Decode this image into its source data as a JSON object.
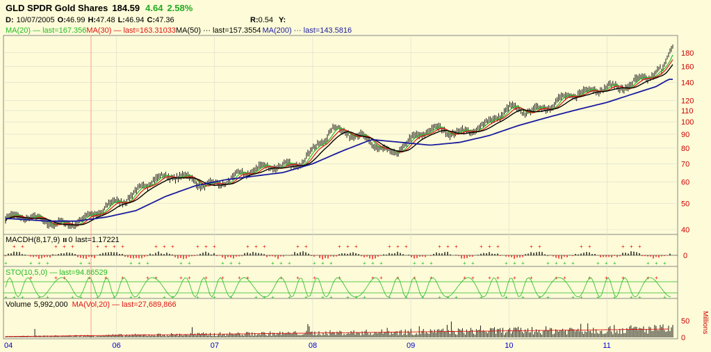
{
  "header": {
    "ticker_name": "GLD SPDR Gold Shares",
    "price": "184.59",
    "change": "4.64",
    "change_pct": "2.58%",
    "ohlc": [
      {
        "label": "D:",
        "value": "10/07/2005"
      },
      {
        "label": "O:",
        "value": "46.99"
      },
      {
        "label": "H:",
        "value": "47.48"
      },
      {
        "label": "L:",
        "value": "46.94"
      },
      {
        "label": "C:",
        "value": "47.36"
      }
    ],
    "r_label": "R:",
    "r_value": "0.54",
    "y_label": "Y:"
  },
  "ma_legend": [
    {
      "text": "MA(20)",
      "last": "last=167.356",
      "color": "#22bb22"
    },
    {
      "text": "MA(30)",
      "last": "last=163.31033",
      "color": "#dd1111"
    },
    {
      "text": "MA(50)",
      "last": "last=157.3554",
      "color": "#000000"
    },
    {
      "text": "MA(200)",
      "last": "last=143.5816",
      "color": "#1a1a9e"
    }
  ],
  "macd_legend": "MACDH(8,17,9)",
  "macd_zero": "0",
  "macd_last": "last=1.17221",
  "sto_legend": "STO(10,5,0)",
  "sto_last": "last=94.86529",
  "volume_legend": "Volume",
  "volume_value": "5,992,000",
  "vol_ma_legend": "MA(Vol,20)",
  "vol_ma_last": "last=27,689,866",
  "volume_unit": "Millions",
  "colors": {
    "background": "#fdfbd8",
    "frame": "#888888",
    "grid": "#d8d8c8",
    "price_axis": "#cc0000",
    "date_axis": "#0000cc",
    "candle": "#000000",
    "ma20": "#22bb22",
    "ma30": "#dd1111",
    "ma50": "#000000",
    "ma200": "#1a1a9e",
    "sto": "#22bb22"
  },
  "chart_data": {
    "type": "line",
    "scale": "log",
    "price_ticks": [
      40,
      50,
      60,
      70,
      80,
      90,
      100,
      110,
      120,
      140,
      160,
      180
    ],
    "macd_ticks": [
      0
    ],
    "volume_ticks": [
      0,
      50
    ],
    "x_tick_labels": [
      "04",
      "06",
      "07",
      "08",
      "09",
      "10",
      "11"
    ],
    "x_tick_years": [
      2004.87,
      2006.0,
      2007.0,
      2008.0,
      2009.0,
      2010.0,
      2011.0
    ],
    "x_range": [
      2004.87,
      2011.67
    ],
    "ylim": [
      40,
      200
    ],
    "grid": true,
    "series": [
      {
        "name": "MA(200)",
        "x": [
          2004.87,
          2005.3,
          2005.6,
          2005.9,
          2006.2,
          2006.5,
          2006.8,
          2007.1,
          2007.4,
          2007.7,
          2008.0,
          2008.3,
          2008.6,
          2008.9,
          2009.2,
          2009.5,
          2009.8,
          2010.1,
          2010.4,
          2010.7,
          2011.0,
          2011.3,
          2011.5,
          2011.63
        ],
        "y": [
          44,
          43,
          43,
          44.5,
          47,
          53,
          58,
          61,
          63,
          65,
          70,
          78,
          86,
          84,
          82,
          84,
          89,
          97,
          104,
          111,
          118,
          128,
          135,
          143.6
        ]
      },
      {
        "name": "MA(50)",
        "x": [
          2004.87,
          2005.2,
          2005.5,
          2005.8,
          2006.1,
          2006.35,
          2006.6,
          2006.9,
          2007.2,
          2007.5,
          2007.8,
          2008.0,
          2008.2,
          2008.4,
          2008.6,
          2008.8,
          2009.0,
          2009.2,
          2009.5,
          2009.8,
          2010.0,
          2010.2,
          2010.5,
          2010.8,
          2011.0,
          2011.2,
          2011.5,
          2011.63
        ],
        "y": [
          44,
          43,
          43,
          45,
          52,
          63,
          62,
          58,
          64,
          66,
          70,
          80,
          92,
          88,
          86,
          78,
          84,
          92,
          94,
          98,
          109,
          111,
          121,
          126,
          136,
          140,
          148,
          157.4
        ]
      }
    ]
  }
}
